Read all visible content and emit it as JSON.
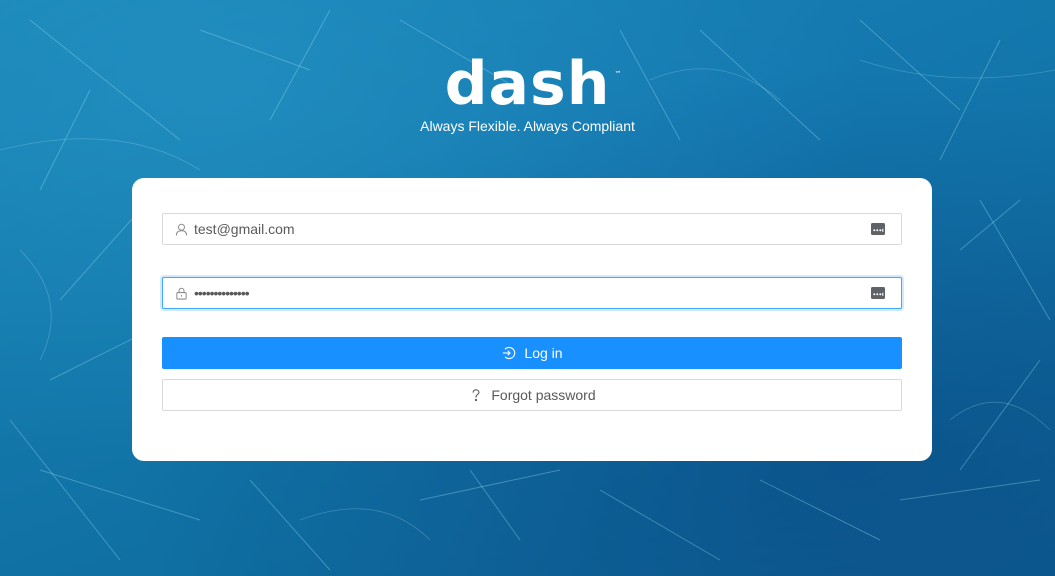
{
  "brand": {
    "logo_text": "dash",
    "trademark": "™",
    "tagline": "Always Flexible. Always Compliant"
  },
  "login_form": {
    "email": {
      "value": "test@gmail.com",
      "icon": "user-icon",
      "suffix_icon": "autofill-key-icon"
    },
    "password": {
      "value": "••••••••••••••",
      "icon": "lock-icon",
      "suffix_icon": "autofill-key-icon"
    },
    "login_button": {
      "label": "Log in",
      "icon": "login-icon"
    },
    "forgot_button": {
      "label": "Forgot password",
      "icon": "question-icon"
    }
  },
  "colors": {
    "background": "#1378ab",
    "primary": "#1890ff",
    "card": "#ffffff",
    "border": "#d9d9d9",
    "focus_border": "#40a9ff"
  }
}
